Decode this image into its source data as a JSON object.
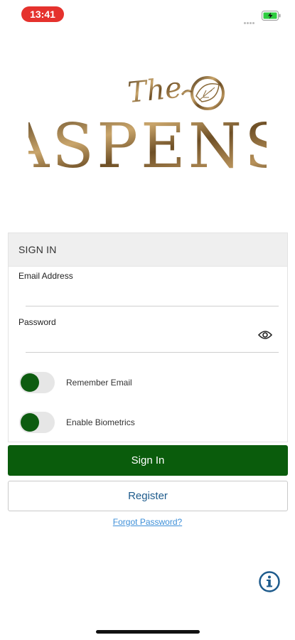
{
  "status_bar": {
    "time": "13:41",
    "icons": [
      "signal-dots-icon",
      "battery-charging-icon"
    ],
    "time_pill_color": "#e5322d",
    "battery_color": "#2ecc40"
  },
  "logo": {
    "script_text": "The",
    "main_text": "ASPENS",
    "icon": "leaf-icon",
    "color": "#8a6a3a"
  },
  "form": {
    "header": "SIGN IN",
    "email_label": "Email Address",
    "email_value": "",
    "password_label": "Password",
    "password_value": "",
    "password_toggle_icon": "eye-icon",
    "toggles": [
      {
        "label": "Remember Email",
        "on": true
      },
      {
        "label": "Enable Biometrics",
        "on": true
      }
    ]
  },
  "buttons": {
    "sign_in": "Sign In",
    "register": "Register",
    "forgot_password": "Forgot Password?"
  },
  "footer": {
    "info_icon": "info-icon"
  },
  "colors": {
    "primary_green": "#0a5c0c",
    "link_blue": "#3d8fd8",
    "register_text": "#1e5b8c",
    "info_blue": "#1e5b8c"
  }
}
